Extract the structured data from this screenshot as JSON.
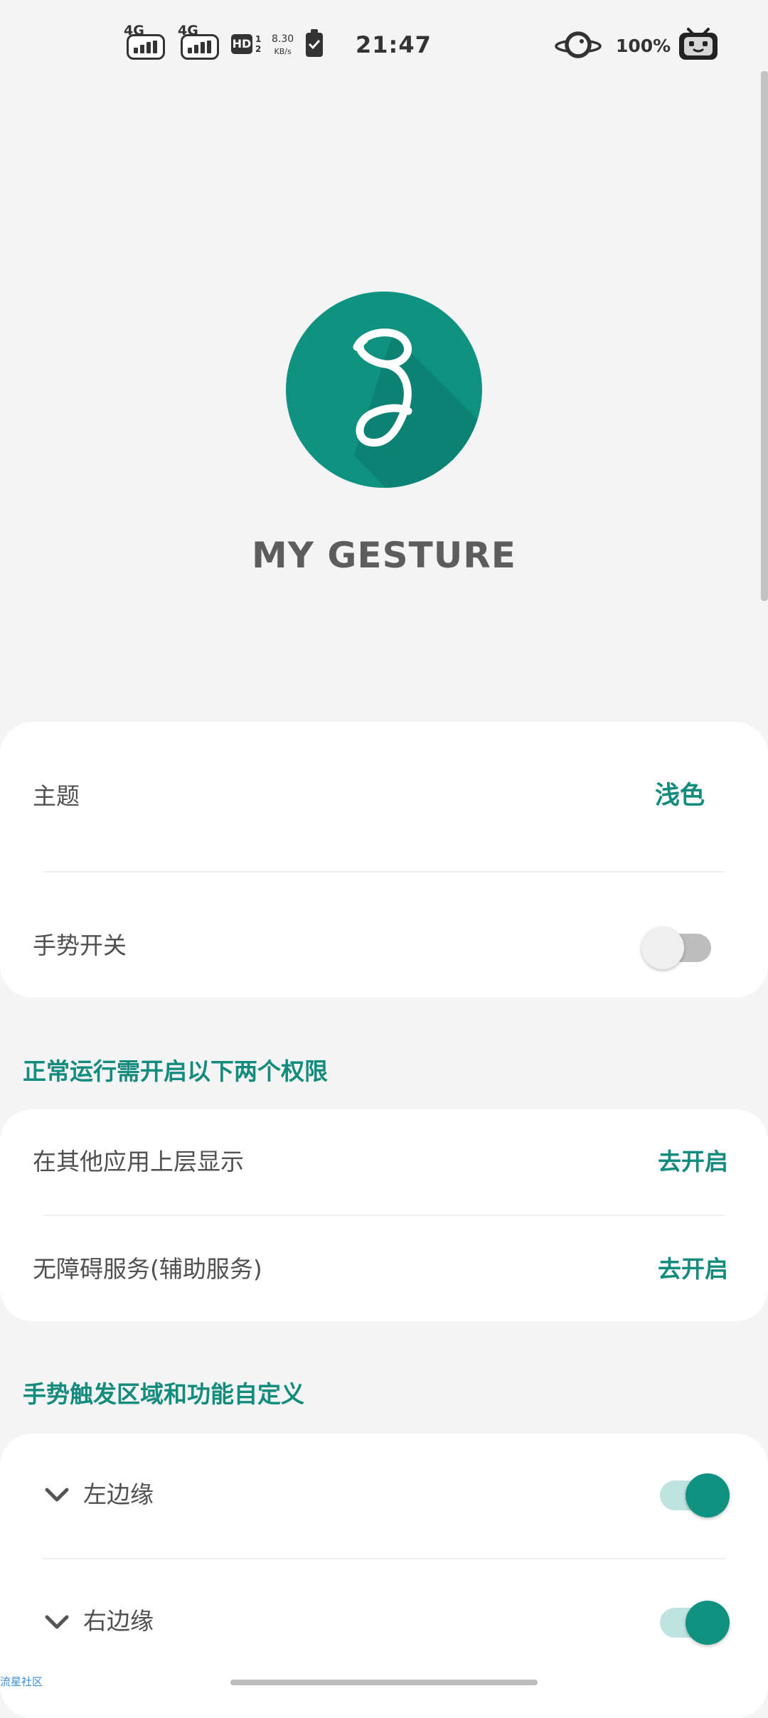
{
  "status_bar": {
    "sim1_network": "4G",
    "sim2_network": "4G",
    "hd_label": "HD",
    "hd_sub1": "1",
    "hd_sub2": "2",
    "speed_value": "8.30",
    "speed_unit": "KB/s",
    "time": "21:47",
    "battery_percent": "100%"
  },
  "app": {
    "name": "MY GESTURE",
    "logo_color": "#0f9282"
  },
  "settings": {
    "theme_label": "主题",
    "theme_value": "浅色",
    "gesture_switch_label": "手势开关",
    "gesture_switch_on": false
  },
  "permissions": {
    "section_title": "正常运行需开启以下两个权限",
    "overlay_label": "在其他应用上层显示",
    "overlay_action": "去开启",
    "accessibility_label": "无障碍服务(辅助服务)",
    "accessibility_action": "去开启"
  },
  "gesture_areas": {
    "section_title": "手势触发区域和功能自定义",
    "items": [
      {
        "label": "左边缘",
        "enabled": true
      },
      {
        "label": "右边缘",
        "enabled": true
      }
    ]
  },
  "watermark": "流星社区",
  "colors": {
    "accent": "#138b7d",
    "background": "#f4f4f4",
    "card": "#ffffff"
  }
}
